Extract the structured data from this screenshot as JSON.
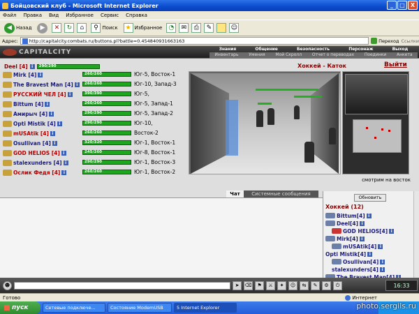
{
  "window": {
    "title": "Бойцовский клуб - Microsoft Internet Explorer",
    "min": "_",
    "max": "□",
    "close": "X"
  },
  "menu": [
    "Файл",
    "Правка",
    "Вид",
    "Избранное",
    "Сервис",
    "Справка"
  ],
  "toolbar": {
    "back": "Назад",
    "search": "Поиск",
    "favorites": "Избранное"
  },
  "address": {
    "label": "Адрес:",
    "url": "http://capitalcity.combats.ru/buttons.pl?battle=0.454840931663163",
    "go": "Переход",
    "links": "Ссылки"
  },
  "game": {
    "logo": "CAPITALCITY",
    "nav_top": [
      "Знания",
      "Общение",
      "Безопасность",
      "Персонаж",
      "Выход"
    ],
    "nav_bottom": [
      "Инвентарь",
      "Умения",
      "Мой Скролл",
      "Отчет о переводах",
      "Поединки",
      "Анкета"
    ],
    "me": {
      "name": "Deel [4]",
      "hp": "290/290"
    },
    "location": "Хоккей - Каток",
    "exit": "Выйти",
    "watch": "смотрим на восток"
  },
  "players": [
    {
      "name": "Mirk [4]",
      "hp": "260/260",
      "pos": "Юг-5, Восток-1"
    },
    {
      "name": "The Bravest Man [4]",
      "hp": "260/260",
      "pos": "Юг-10, Запад-3"
    },
    {
      "name": "РУССКИЙ ЧЕЛ [4]",
      "hp": "390/390",
      "pos": "Юг-5,"
    },
    {
      "name": "Bittum [4]",
      "hp": "260/260",
      "pos": "Юг-5, Запад-1"
    },
    {
      "name": "Амирыч [4]",
      "hp": "290/290",
      "pos": "Юг-5, Запад-2"
    },
    {
      "name": "Opti Mistik [4]",
      "hp": "290/290",
      "pos": "Юг-10,"
    },
    {
      "name": "mUSAtik [4]",
      "hp": "260/260",
      "pos": "Восток-2"
    },
    {
      "name": "Osullivan [4]",
      "hp": "320/320",
      "pos": "Юг-1, Восток-1"
    },
    {
      "name": "GOD HELIOS [4]",
      "hp": "245/260",
      "pos": "Юг-8, Восток-1"
    },
    {
      "name": "stalexunders [4]",
      "hp": "290/290",
      "pos": "Юг-1, Восток-3"
    },
    {
      "name": "Ослик Федя [4]",
      "hp": "260/260",
      "pos": "Юг-1, Восток-2"
    }
  ],
  "chat": {
    "tab_chat": "Чат",
    "tab_system": "Системные сообщения"
  },
  "room": {
    "refresh": "Обновить",
    "title": "Хоккей (12)",
    "list": [
      "Bittum[4]",
      "Deel[4]",
      "GOD HELIOS[4]",
      "Mirk[4]",
      "mUSAtik[4]",
      "Opti Mistik[4]",
      "Osullivan[4]",
      "stalexunders[4]",
      "The Bravest Man[4]"
    ]
  },
  "clock": "16:33",
  "status": {
    "left": "Готово",
    "zone": "Интернет"
  },
  "taskbar": {
    "start": "пуск",
    "tasks": [
      "Сетевые подключе...",
      "Состояние ModemUSB",
      "5 Internet Explorer"
    ]
  },
  "watermark": "photo.sergils.ru"
}
